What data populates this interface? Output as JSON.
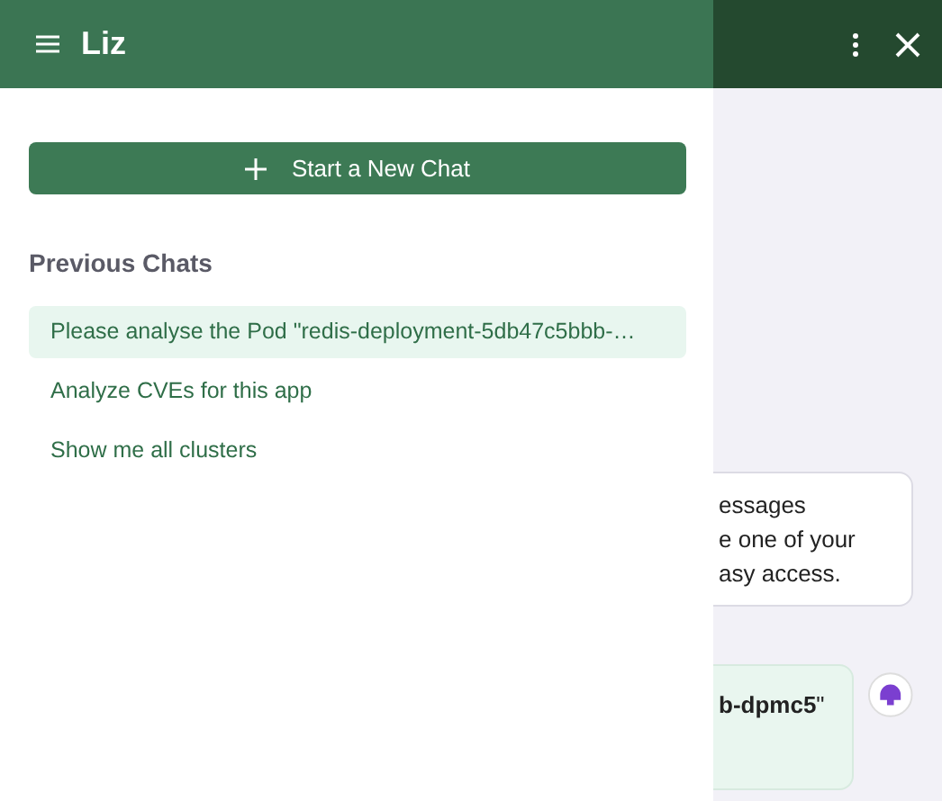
{
  "header": {
    "title": "Liz"
  },
  "drawer": {
    "new_chat_button": "Start a New Chat",
    "section_title": "Previous Chats",
    "chats": [
      {
        "title": "Please analyse the Pod \"redis-deployment-5db47c5bbb-…",
        "selected": true
      },
      {
        "title": "Analyze CVEs for this app",
        "selected": false
      },
      {
        "title": "Show me all clusters",
        "selected": false
      }
    ]
  },
  "chat": {
    "tip_lines": [
      "essages",
      "e one of your",
      "asy access."
    ],
    "messages": [
      {
        "text": "**b-dpmc5**\""
      }
    ]
  }
}
